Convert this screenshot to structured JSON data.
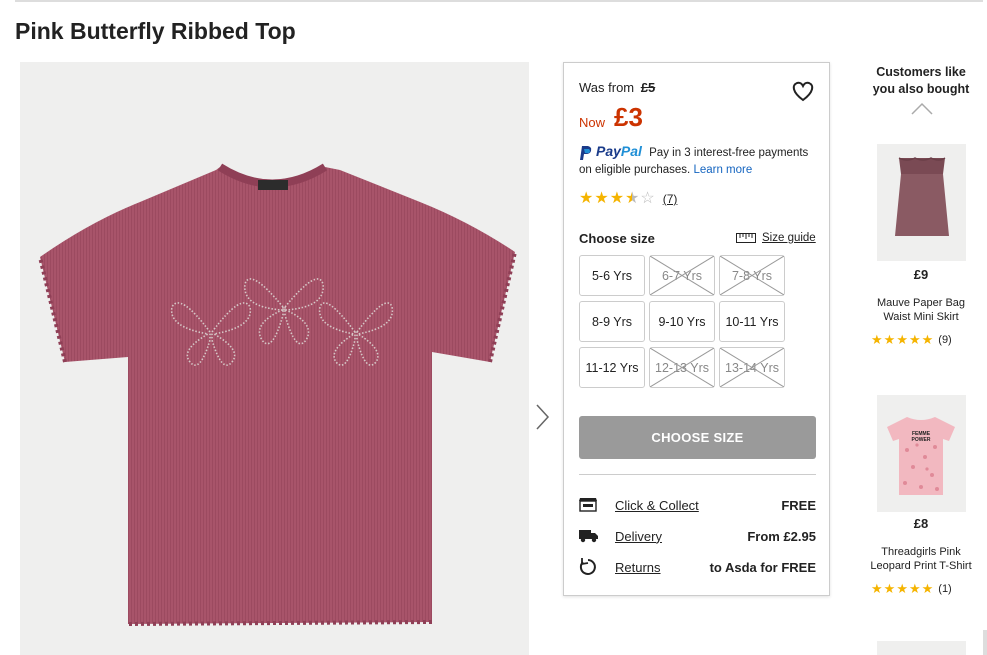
{
  "product": {
    "title": "Pink Butterfly Ribbed Top",
    "image_icon": "tshirt-image",
    "colors": {
      "shirt": "#a8546a",
      "accent_price": "#cc3300",
      "button_disabled": "#9a9a9a",
      "star": "#f5b400",
      "link": "#1565c0"
    }
  },
  "price": {
    "was_label": "Was from",
    "was_value": "£5",
    "now_label": "Now",
    "now_value": "£3"
  },
  "paypal": {
    "brand_pay": "Pay",
    "brand_pal": "Pal",
    "text": "Pay in 3 interest-free payments on eligible purchases.",
    "learn_more": "Learn more"
  },
  "rating": {
    "value": 3.5,
    "max": 5,
    "count_label": "(7)"
  },
  "size": {
    "label": "Choose size",
    "guide_label": "Size guide",
    "options": [
      {
        "label": "5-6 Yrs",
        "available": true
      },
      {
        "label": "6-7 Yrs",
        "available": false
      },
      {
        "label": "7-8 Yrs",
        "available": false
      },
      {
        "label": "8-9 Yrs",
        "available": true
      },
      {
        "label": "9-10 Yrs",
        "available": true
      },
      {
        "label": "10-11 Yrs",
        "available": true
      },
      {
        "label": "11-12 Yrs",
        "available": true
      },
      {
        "label": "12-13 Yrs",
        "available": false
      },
      {
        "label": "13-14 Yrs",
        "available": false
      }
    ],
    "button_label": "CHOOSE SIZE"
  },
  "fulfilment": [
    {
      "icon": "store-icon",
      "label": "Click & Collect",
      "value": "FREE"
    },
    {
      "icon": "truck-icon",
      "label": "Delivery",
      "value": "From £2.95"
    },
    {
      "icon": "returns-icon",
      "label": "Returns",
      "value": "to Asda for FREE"
    }
  ],
  "recommendations": {
    "title_line1": "Customers like",
    "title_line2": "you also bought",
    "items": [
      {
        "price": "£9",
        "name_line1": "Mauve Paper Bag",
        "name_line2": "Waist Mini Skirt",
        "rating": 5,
        "count": "(9)",
        "image_icon": "skirt-image"
      },
      {
        "price": "£8",
        "name_line1": "Threadgirls Pink",
        "name_line2": "Leopard Print T-Shirt",
        "rating": 5,
        "count": "(1)",
        "image_icon": "leopard-tshirt-image",
        "print_text_1": "FEMME",
        "print_text_2": "POWER"
      }
    ]
  }
}
